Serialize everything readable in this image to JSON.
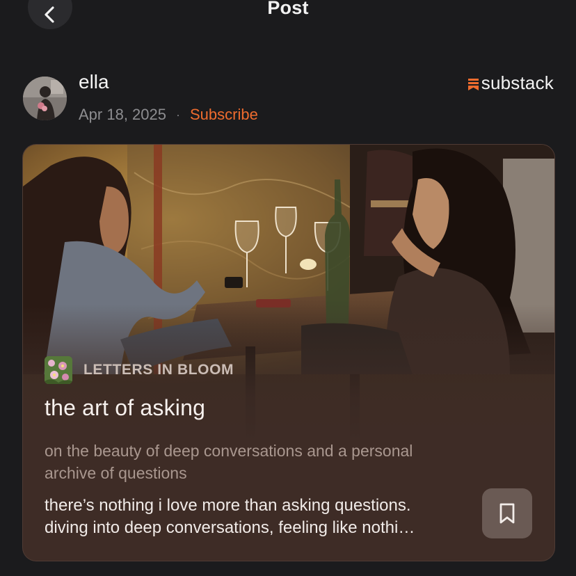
{
  "header": {
    "title": "Post",
    "back_icon": "chevron-left-icon"
  },
  "author": {
    "name": "ella",
    "date": "Apr 18, 2025",
    "separator": "·",
    "subscribe_label": "Subscribe",
    "avatar_icon": "avatar"
  },
  "brand": {
    "name": "substack",
    "logo_icon": "substack-logo-icon",
    "logo_color": "#ef6c2e"
  },
  "card": {
    "publication_name": "LETTERS IN BLOOM",
    "publication_icon": "flower-thumbnail-icon",
    "title": "the art of asking",
    "subtitle": "on the beauty of deep conversations and a personal archive of questions",
    "excerpt_line1": "there’s nothing i love more than asking questions.",
    "excerpt_line2": "diving into deep conversations, feeling like nothi…",
    "bookmark_icon": "bookmark-icon"
  },
  "colors": {
    "background": "#1b1b1d",
    "accent": "#ef6c2e",
    "card_background": "#3e2c26"
  }
}
